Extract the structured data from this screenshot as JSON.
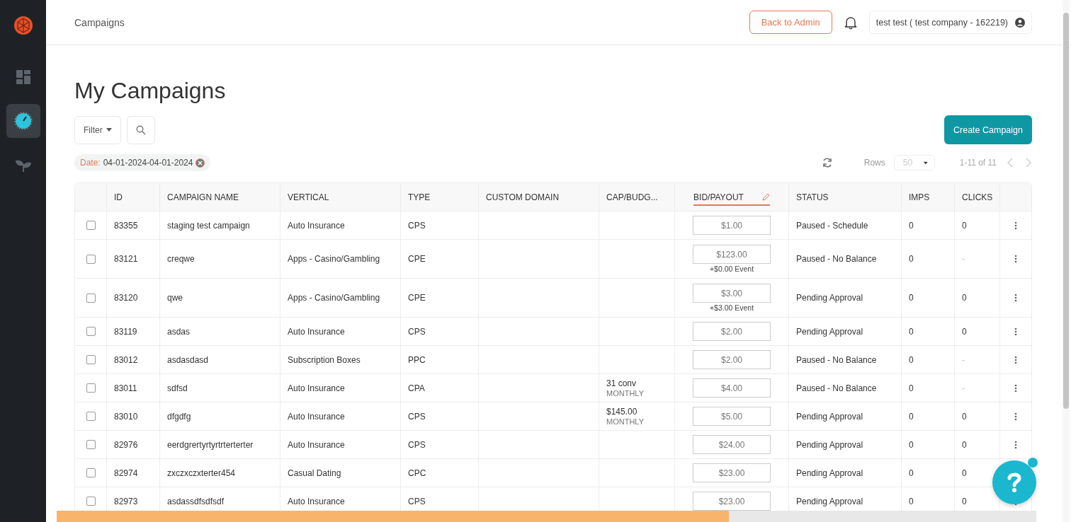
{
  "sidebar": {
    "items": [
      {
        "kind": "dashboard",
        "selected": false
      },
      {
        "kind": "campaigns",
        "selected": true
      },
      {
        "kind": "sprout",
        "selected": false
      }
    ]
  },
  "header": {
    "breadcrumb": "Campaigns",
    "back_button": "Back to Admin",
    "user": "test test ( test company - 162219)"
  },
  "page_title": "My Campaigns",
  "toolbar": {
    "filter": "Filter",
    "create_button": "Create Campaign"
  },
  "filter_chip": {
    "label": "Date:",
    "value": "04-01-2024-04-01-2024"
  },
  "pagination": {
    "rows_label": "Rows",
    "rows_value": "50",
    "range": "1-11 of 11"
  },
  "table": {
    "columns": [
      "ID",
      "CAMPAIGN NAME",
      "VERTICAL",
      "TYPE",
      "CUSTOM DOMAIN",
      "CAP/BUDG...",
      "BID/PAYOUT",
      "STATUS",
      "IMPS",
      "CLICKS"
    ],
    "rows": [
      {
        "checked": false,
        "id": "83355",
        "name": "staging test campaign",
        "vertical": "Auto Insurance",
        "type": "CPS",
        "bid": "$1.00",
        "status": "Paused - Schedule",
        "imps": "0",
        "clicks": "0"
      },
      {
        "checked": false,
        "id": "83121",
        "name": "creqwe",
        "vertical": "Apps - Casino/Gambling",
        "type": "CPE",
        "bid": "$123.00",
        "bid_event": "+$0.00 Event",
        "status": "Paused - No Balance",
        "imps": "0",
        "clicks": "-"
      },
      {
        "checked": false,
        "id": "83120",
        "name": "qwe",
        "vertical": "Apps - Casino/Gambling",
        "type": "CPE",
        "bid": "$3.00",
        "bid_event": "+$3.00 Event",
        "status": "Pending Approval",
        "imps": "0",
        "clicks": "0"
      },
      {
        "checked": false,
        "id": "83119",
        "name": "asdas",
        "vertical": "Auto Insurance",
        "type": "CPS",
        "bid": "$2.00",
        "status": "Pending Approval",
        "imps": "0",
        "clicks": "0"
      },
      {
        "checked": false,
        "id": "83012",
        "name": "asdasdasd",
        "vertical": "Subscription Boxes",
        "type": "PPC",
        "bid": "$2.00",
        "status": "Paused - No Balance",
        "imps": "0",
        "clicks": "-"
      },
      {
        "checked": false,
        "id": "83011",
        "name": "sdfsd",
        "vertical": "Auto Insurance",
        "type": "CPA",
        "cap": "31 conv",
        "cap_period": "MONTHLY",
        "bid": "$4.00",
        "status": "Paused - No Balance",
        "imps": "0",
        "clicks": "-"
      },
      {
        "checked": false,
        "id": "83010",
        "name": "dfgdfg",
        "vertical": "Auto Insurance",
        "type": "CPS",
        "cap": "$145.00",
        "cap_period": "MONTHLY",
        "bid": "$5.00",
        "status": "Pending Approval",
        "imps": "0",
        "clicks": "0"
      },
      {
        "checked": false,
        "id": "82976",
        "name": "eerdgrertyrtyrtrterterter",
        "vertical": "Auto Insurance",
        "type": "CPS",
        "bid": "$24.00",
        "status": "Pending Approval",
        "imps": "0",
        "clicks": "0"
      },
      {
        "checked": false,
        "id": "82974",
        "name": "zxczxczxterter454",
        "vertical": "Casual Dating",
        "type": "CPC",
        "bid": "$23.00",
        "status": "Pending Approval",
        "imps": "0",
        "clicks": "0"
      },
      {
        "checked": false,
        "id": "82973",
        "name": "asdassdfsdfsdf",
        "vertical": "Auto Insurance",
        "type": "CPS",
        "bid": "$23.00",
        "status": "Pending Approval",
        "imps": "0",
        "clicks": "0"
      }
    ]
  }
}
